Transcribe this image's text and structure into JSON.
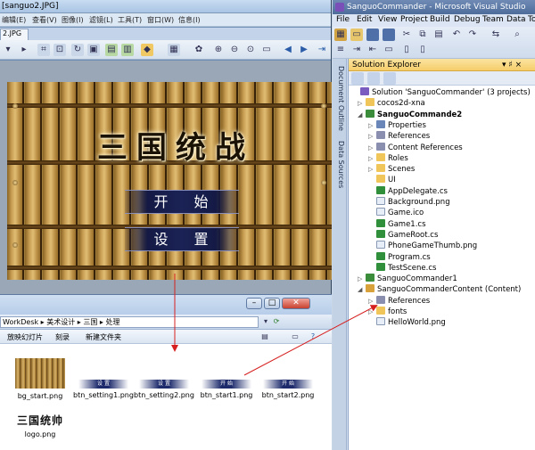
{
  "viewer": {
    "title": "[sanguo2.JPG]",
    "menu": [
      "编辑(E)",
      "查看(V)",
      "图像(I)",
      "滤镜(L)",
      "工具(T)",
      "窗口(W)",
      "信息(I)"
    ],
    "tab": "2.JPG"
  },
  "game": {
    "title": "三国统战",
    "start_label": "开 始",
    "settings_label": "设 置"
  },
  "vs": {
    "title": "SanguoCommander - Microsoft Visual Studio",
    "menu": [
      "File",
      "Edit",
      "View",
      "Project",
      "Build",
      "Debug",
      "Team",
      "Data",
      "To"
    ],
    "side_tabs": [
      "Document Outline",
      "Data Sources"
    ],
    "solution_explorer": {
      "header": "Solution Explorer",
      "pin": "▾ ♯ ×",
      "nodes": [
        {
          "text": "Solution 'SanguoCommander' (3 projects)",
          "icon": "sol",
          "level": 0,
          "expander": "",
          "bold": false
        },
        {
          "text": "cocos2d-xna",
          "icon": "folder",
          "level": 1,
          "expander": "▷",
          "bold": false
        },
        {
          "text": "SanguoCommande2",
          "icon": "proj",
          "level": 1,
          "expander": "◢",
          "bold": true
        },
        {
          "text": "Properties",
          "icon": "prop",
          "level": 2,
          "expander": "▷",
          "bold": false
        },
        {
          "text": "References",
          "icon": "ref",
          "level": 2,
          "expander": "▷",
          "bold": false
        },
        {
          "text": "Content References",
          "icon": "ref",
          "level": 2,
          "expander": "▷",
          "bold": false
        },
        {
          "text": "Roles",
          "icon": "folder",
          "level": 2,
          "expander": "▷",
          "bold": false
        },
        {
          "text": "Scenes",
          "icon": "folder",
          "level": 2,
          "expander": "▷",
          "bold": false
        },
        {
          "text": "UI",
          "icon": "folder",
          "level": 2,
          "expander": "",
          "bold": false
        },
        {
          "text": "AppDelegate.cs",
          "icon": "cs",
          "level": 2,
          "expander": "",
          "bold": false
        },
        {
          "text": "Background.png",
          "icon": "file",
          "level": 2,
          "expander": "",
          "bold": false
        },
        {
          "text": "Game.ico",
          "icon": "file",
          "level": 2,
          "expander": "",
          "bold": false
        },
        {
          "text": "Game1.cs",
          "icon": "cs",
          "level": 2,
          "expander": "",
          "bold": false
        },
        {
          "text": "GameRoot.cs",
          "icon": "cs",
          "level": 2,
          "expander": "",
          "bold": false
        },
        {
          "text": "PhoneGameThumb.png",
          "icon": "file",
          "level": 2,
          "expander": "",
          "bold": false
        },
        {
          "text": "Program.cs",
          "icon": "cs",
          "level": 2,
          "expander": "",
          "bold": false
        },
        {
          "text": "TestScene.cs",
          "icon": "cs",
          "level": 2,
          "expander": "",
          "bold": false
        },
        {
          "text": "SanguoCommander1",
          "icon": "proj",
          "level": 1,
          "expander": "▷",
          "bold": false
        },
        {
          "text": "SanguoCommanderContent (Content)",
          "icon": "content",
          "level": 1,
          "expander": "◢",
          "bold": false
        },
        {
          "text": "References",
          "icon": "ref",
          "level": 2,
          "expander": "▷",
          "bold": false
        },
        {
          "text": "fonts",
          "icon": "folder",
          "level": 2,
          "expander": "▷",
          "bold": false
        },
        {
          "text": "HelloWorld.png",
          "icon": "file",
          "level": 2,
          "expander": "",
          "bold": false
        }
      ]
    }
  },
  "explorer": {
    "path": "WorkDesk ▸ 美术设计 ▸ 三国 ▸ 处理",
    "commands": [
      "放映幻灯片",
      "刻录",
      "新建文件夹"
    ],
    "files": [
      {
        "name": "bg_start.png",
        "kind": "bg"
      },
      {
        "name": "btn_setting1.png",
        "kind": "bar",
        "label": "设 置"
      },
      {
        "name": "btn_setting2.png",
        "kind": "bar",
        "label": "设 置"
      },
      {
        "name": "btn_start1.png",
        "kind": "bar",
        "label": "开 始"
      },
      {
        "name": "btn_start2.png",
        "kind": "bar",
        "label": "开 始"
      },
      {
        "name": "logo.png",
        "kind": "logo",
        "label": "三国统帅"
      }
    ]
  }
}
